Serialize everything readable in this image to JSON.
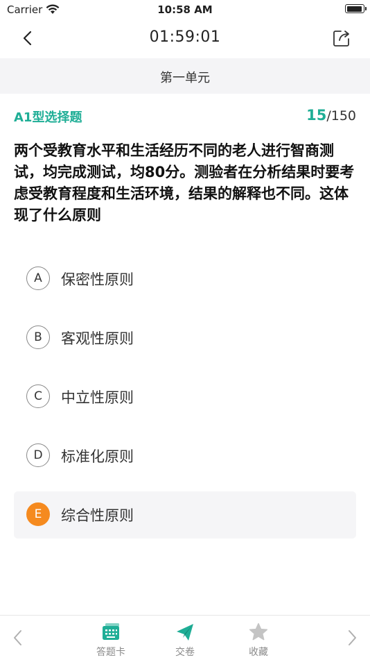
{
  "status": {
    "carrier": "Carrier",
    "time": "10:58 AM",
    "battery_level": 1.0
  },
  "nav": {
    "timer": "01:59:01",
    "back_icon": "chevron-left-icon",
    "share_icon": "share-icon"
  },
  "section": {
    "title": "第一单元"
  },
  "question": {
    "type": "A1型选择题",
    "current": "15",
    "total": "/150",
    "text": "两个受教育水平和生活经历不同的老人进行智商测试，均完成测试，均80分。测验者在分析结果时要考虑受教育程度和生活环境，结果的解释也不同。这体现了什么原则"
  },
  "options": [
    {
      "letter": "A",
      "text": "保密性原则"
    },
    {
      "letter": "B",
      "text": "客观性原则"
    },
    {
      "letter": "C",
      "text": "中立性原则"
    },
    {
      "letter": "D",
      "text": "标准化原则"
    },
    {
      "letter": "E",
      "text": "综合性原则"
    }
  ],
  "selected_option": "E",
  "tabbar": {
    "answer_card": "答题卡",
    "submit": "交卷",
    "favorite": "收藏"
  },
  "colors": {
    "accent": "#1fae96",
    "selected": "#f58a1f"
  }
}
